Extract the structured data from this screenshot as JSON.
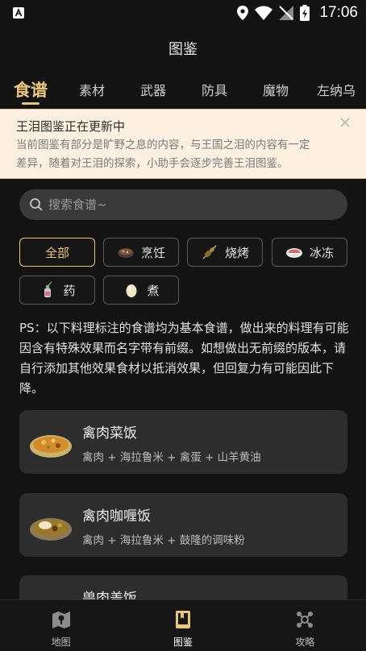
{
  "status_bar": {
    "time": "17:06"
  },
  "header": {
    "title": "图鉴"
  },
  "tabs": [
    {
      "label": "食谱",
      "active": true
    },
    {
      "label": "素材"
    },
    {
      "label": "武器"
    },
    {
      "label": "防具"
    },
    {
      "label": "魔物"
    },
    {
      "label": "左纳乌"
    }
  ],
  "notice": {
    "title": "王泪图鉴正在更新中",
    "body_line1": "当前图鉴有部分是旷野之息的内容，与王国之泪的内容有一定",
    "body_line2": "差异，随着对王泪的探索，小助手会逐步完善王泪图鉴。"
  },
  "search": {
    "placeholder": "搜索食谱~"
  },
  "filters": [
    {
      "label": "全部",
      "active": true
    },
    {
      "label": "烹饪",
      "icon": "cooking-pot-icon"
    },
    {
      "label": "烧烤",
      "icon": "skewer-icon"
    },
    {
      "label": "冰冻",
      "icon": "ice-icon"
    },
    {
      "label": "药",
      "icon": "medicine-icon"
    },
    {
      "label": "煮",
      "icon": "egg-icon"
    }
  ],
  "ps_text": "PS：以下料理标注的食谱均为基本食谱，做出来的料理有可能因含有特殊效果而名字带有前缀。如想做出无前缀的版本，请自行添加其他效果食材以抵消效果，但回复力有可能因此下降。",
  "recipes": [
    {
      "name": "禽肉菜饭",
      "ingredients": "禽肉 + 海拉鲁米 + 禽蛋 + 山羊黄油"
    },
    {
      "name": "禽肉咖喱饭",
      "ingredients": "禽肉 + 海拉鲁米 + 鼓隆的调味粉"
    },
    {
      "name": "兽肉盖饭",
      "ingredients": ""
    }
  ],
  "bottom_nav": [
    {
      "label": "地图",
      "icon": "map-icon"
    },
    {
      "label": "图鉴",
      "icon": "book-icon",
      "active": true
    },
    {
      "label": "攻略",
      "icon": "network-icon"
    }
  ],
  "colors": {
    "accent": "#e9c77a",
    "background": "#131313",
    "card": "#2d2d2d",
    "notice_bg": "#fdf0e0"
  }
}
